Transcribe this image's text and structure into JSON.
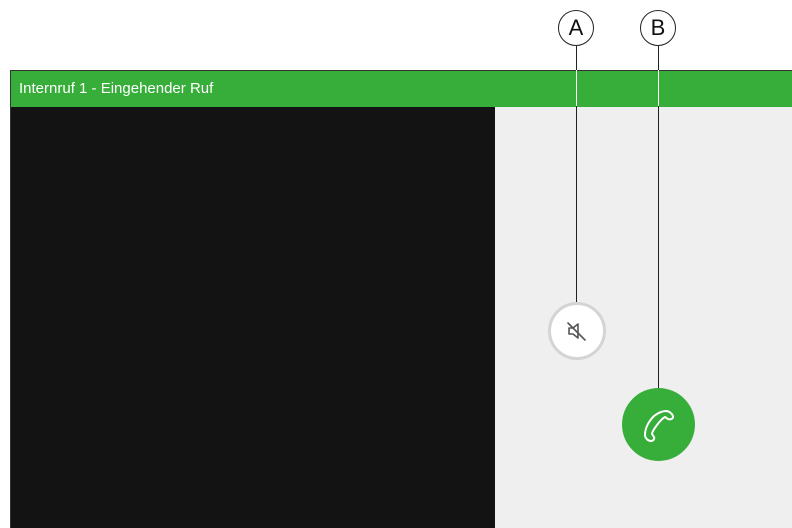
{
  "window": {
    "title": "Internruf 1 - Eingehender Ruf"
  },
  "controls": {
    "mute_icon": "speaker-muted-icon",
    "accept_icon": "phone-handset-icon"
  },
  "callouts": {
    "a_label": "A",
    "b_label": "B"
  },
  "colors": {
    "accent_green": "#37ae3a",
    "video_background": "#131313",
    "panel_background": "#efefef"
  }
}
